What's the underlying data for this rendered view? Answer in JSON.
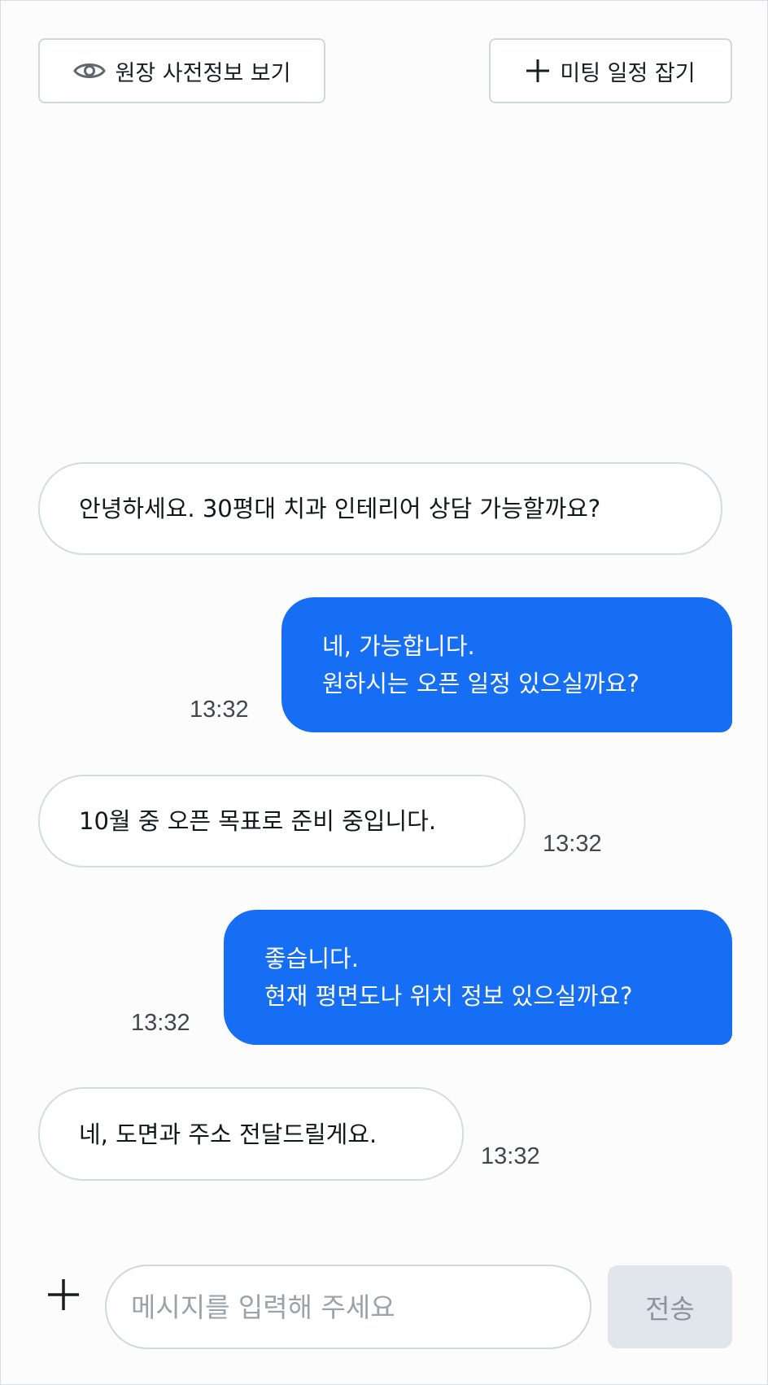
{
  "header": {
    "preview_label": "원장 사전정보 보기",
    "preview_icon": "eye-icon",
    "meeting_label": "미팅 일정 잡기",
    "meeting_icon": "plus-icon"
  },
  "messages": [
    {
      "direction": "in",
      "lines": [
        "안녕하세요. 30평대 치과 인테리어 상담 가능할까요?"
      ],
      "time": ""
    },
    {
      "direction": "out",
      "lines": [
        "네, 가능합니다.",
        "원하시는 오픈 일정 있으실까요?"
      ],
      "time": "13:32"
    },
    {
      "direction": "in",
      "lines": [
        "10월 중 오픈 목표로 준비 중입니다."
      ],
      "time": "13:32"
    },
    {
      "direction": "out",
      "lines": [
        "좋습니다.",
        "현재 평면도나 위치 정보 있으실까요?"
      ],
      "time": "13:32"
    },
    {
      "direction": "in",
      "lines": [
        "네, 도면과 주소 전달드릴게요."
      ],
      "time": "13:32"
    }
  ],
  "composer": {
    "attach_icon": "plus-icon",
    "placeholder": "메시지를 입력해 주세요",
    "value": "",
    "send_label": "전송"
  },
  "colors": {
    "outgoing_bubble": "#166ef5",
    "incoming_bubble": "#ffffff",
    "border": "#cfd8e0",
    "send_disabled_bg": "#e0e6ec"
  }
}
